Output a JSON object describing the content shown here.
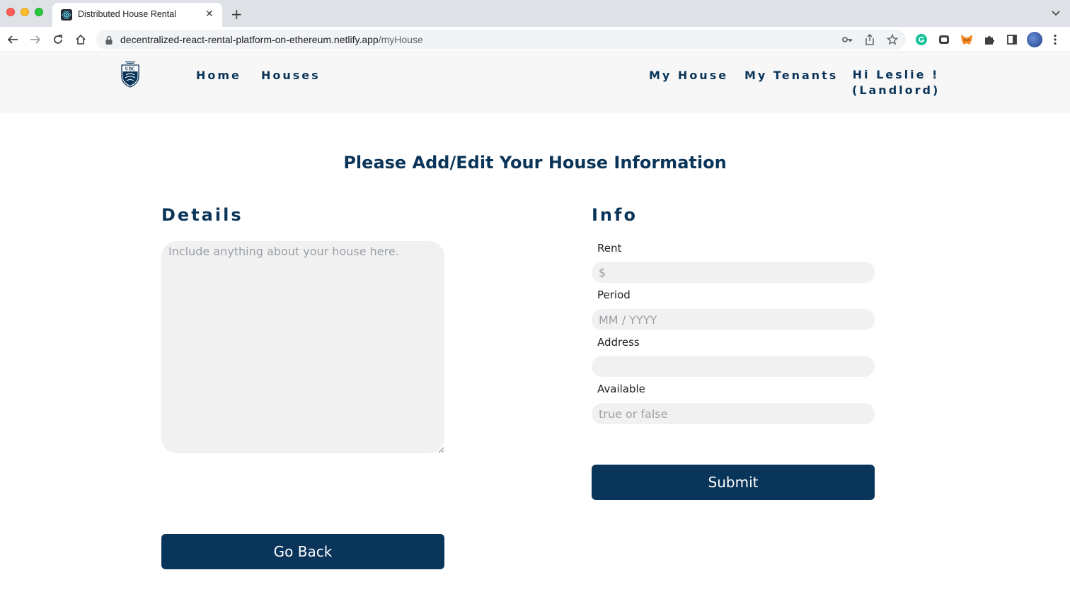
{
  "browser": {
    "tab_title": "Distributed House Rental",
    "tab_close": "✕",
    "new_tab": "+",
    "url_host": "decentralized-react-rental-platform-on-ethereum.netlify.app",
    "url_path": "/myHouse"
  },
  "nav": {
    "left_links": [
      "Home",
      "Houses"
    ],
    "right_links": [
      "My House",
      "My Tenants"
    ],
    "greeting_line1": "Hi Leslie !",
    "greeting_line2": "(Landlord)"
  },
  "page": {
    "title": "Please Add/Edit Your House Information",
    "details_heading": "Details",
    "info_heading": "Info",
    "details_placeholder": "Include anything about your house here.",
    "fields": [
      {
        "label": "Rent",
        "placeholder": "$",
        "value": ""
      },
      {
        "label": "Period",
        "placeholder": "MM / YYYY",
        "value": ""
      },
      {
        "label": "Address",
        "placeholder": "",
        "value": ""
      },
      {
        "label": "Available",
        "placeholder": "true or false",
        "value": ""
      }
    ],
    "submit_label": "Submit",
    "back_label": "Go Back"
  },
  "colors": {
    "primary": "#0a355a",
    "nav_background": "#f7f7f7",
    "input_background": "#f1f1f1"
  },
  "icons": [
    "back-arrow-icon",
    "forward-arrow-icon",
    "reload-icon",
    "home-icon",
    "lock-icon",
    "key-icon",
    "share-icon",
    "star-icon",
    "grammarly-icon",
    "extension-icon",
    "metamask-icon",
    "puzzle-icon",
    "sidepanel-icon",
    "profile-avatar",
    "menu-kebab-icon",
    "ubc-logo"
  ]
}
